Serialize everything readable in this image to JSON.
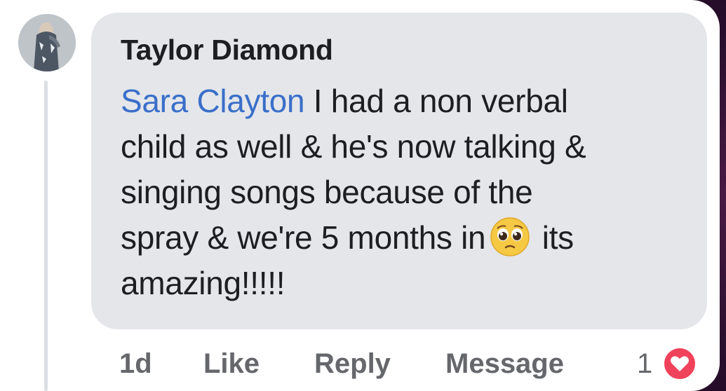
{
  "comment": {
    "author": "Taylor Diamond",
    "mention": "Sara Clayton",
    "text_lines": [
      " I had a non verbal",
      "child as well & he's now talking &",
      "singing songs because of the",
      "spray & we're 5 months in",
      " its",
      "amazing!!!!!"
    ],
    "emoji": "pleading-face-icon"
  },
  "actions": {
    "timestamp": "1d",
    "like_label": "Like",
    "reply_label": "Reply",
    "message_label": "Message"
  },
  "reactions": {
    "count": "1",
    "type": "heart-icon",
    "color": "#f0425a"
  },
  "colors": {
    "bubble": "#e4e6ea",
    "mention": "#3a6fc9",
    "text": "#1c1e21",
    "muted": "#65676b"
  }
}
